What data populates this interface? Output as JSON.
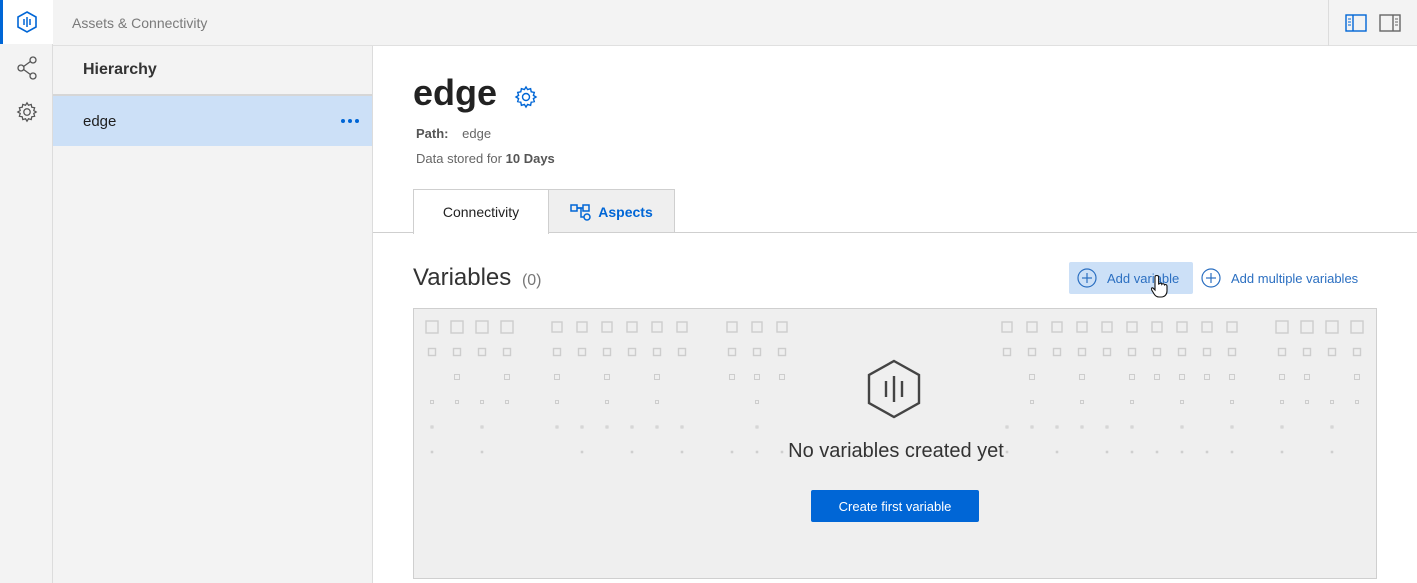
{
  "app": {
    "title": "Assets & Connectivity"
  },
  "rail": {
    "items": [
      {
        "icon": "app-logo-icon",
        "active": true
      },
      {
        "icon": "share-icon",
        "active": false
      },
      {
        "icon": "gear-icon",
        "active": false
      }
    ]
  },
  "topbar": {
    "buttons": [
      "panel-left-icon",
      "panel-right-icon"
    ]
  },
  "hierarchy": {
    "header": "Hierarchy",
    "items": [
      {
        "label": "edge",
        "selected": true
      }
    ]
  },
  "asset": {
    "name": "edge",
    "path_label": "Path:",
    "path_value": "edge",
    "stored_prefix": "Data stored for",
    "stored_value": "10 Days"
  },
  "tabs": [
    {
      "label": "Connectivity",
      "active": true
    },
    {
      "label": "Aspects",
      "active": false,
      "icon": "aspects-icon"
    }
  ],
  "variables": {
    "title": "Variables",
    "count": "(0)",
    "add_label": "Add variable",
    "add_multiple_label": "Add multiple variables",
    "empty_text": "No variables created yet",
    "create_first_label": "Create first variable"
  },
  "colors": {
    "accent": "#0066d6",
    "selected_bg": "#cce0f7"
  }
}
